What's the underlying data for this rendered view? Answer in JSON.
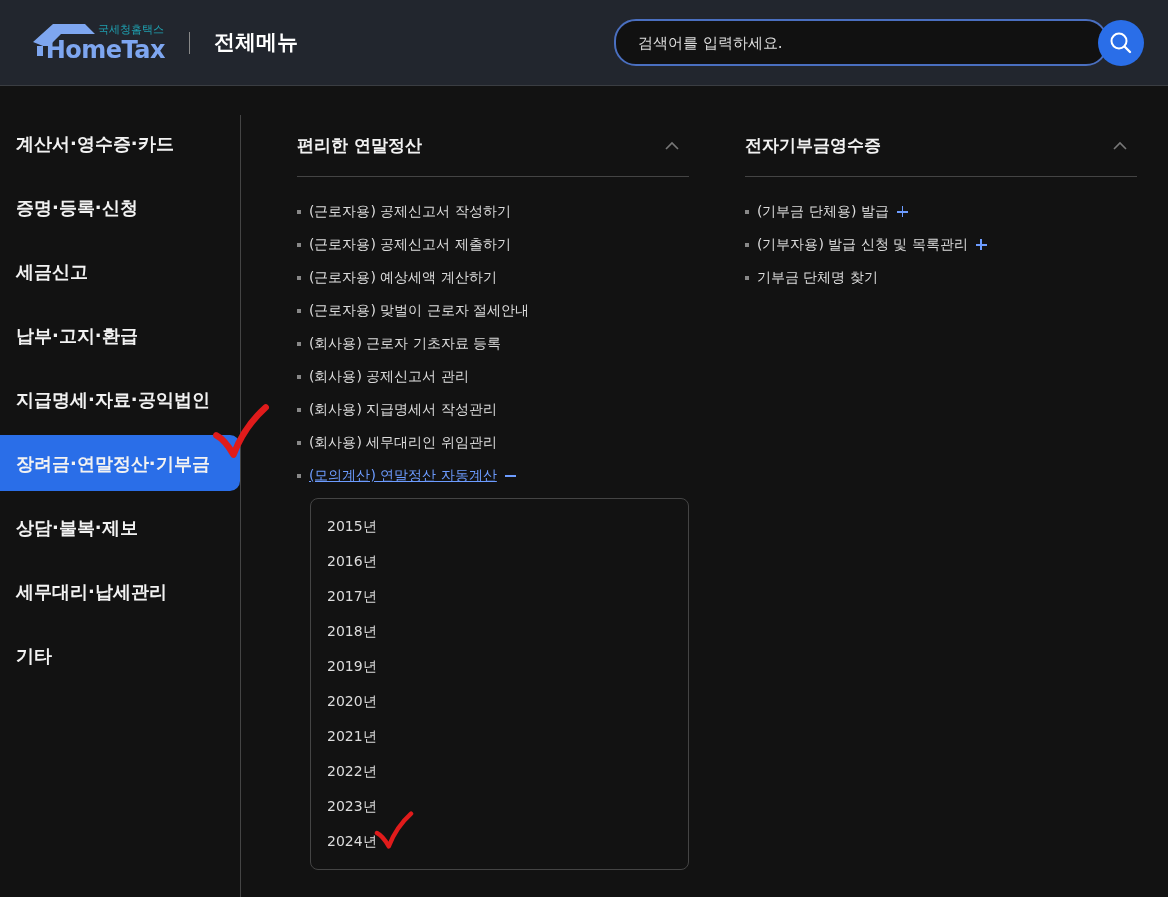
{
  "header": {
    "logo": {
      "subtitle": "국세청홈택스",
      "name": "HomeTax"
    },
    "title": "전체메뉴",
    "search": {
      "placeholder": "검색어를 입력하세요."
    }
  },
  "sidebar": {
    "items": [
      {
        "label": "계산서·영수증·카드",
        "selected": false,
        "marked": false
      },
      {
        "label": "증명·등록·신청",
        "selected": false,
        "marked": false
      },
      {
        "label": "세금신고",
        "selected": false,
        "marked": false
      },
      {
        "label": "납부·고지·환급",
        "selected": false,
        "marked": false
      },
      {
        "label": "지급명세·자료·공익법인",
        "selected": false,
        "marked": false
      },
      {
        "label": "장려금·연말정산·기부금",
        "selected": true,
        "marked": true
      },
      {
        "label": "상담·불복·제보",
        "selected": false,
        "marked": false
      },
      {
        "label": "세무대리·납세관리",
        "selected": false,
        "marked": false
      },
      {
        "label": "기타",
        "selected": false,
        "marked": false
      }
    ]
  },
  "sections": [
    {
      "title": "편리한 연말정산",
      "expanded": true,
      "items": [
        {
          "label": "(근로자용) 공제신고서 작성하기",
          "kind": "plain"
        },
        {
          "label": "(근로자용) 공제신고서 제출하기",
          "kind": "plain"
        },
        {
          "label": "(근로자용) 예상세액 계산하기",
          "kind": "plain"
        },
        {
          "label": "(근로자용) 맞벌이 근로자 절세안내",
          "kind": "plain"
        },
        {
          "label": "(회사용) 근로자 기초자료 등록",
          "kind": "plain"
        },
        {
          "label": "(회사용) 공제신고서 관리",
          "kind": "plain"
        },
        {
          "label": "(회사용) 지급명세서 작성관리",
          "kind": "plain"
        },
        {
          "label": "(회사용) 세무대리인 위임관리",
          "kind": "plain"
        },
        {
          "label": "(모의계산) 연말정산 자동계산",
          "kind": "toggle",
          "expanded": true,
          "children": [
            {
              "label": "2015년",
              "marked": false
            },
            {
              "label": "2016년",
              "marked": false
            },
            {
              "label": "2017년",
              "marked": false
            },
            {
              "label": "2018년",
              "marked": false
            },
            {
              "label": "2019년",
              "marked": false
            },
            {
              "label": "2020년",
              "marked": false
            },
            {
              "label": "2021년",
              "marked": false
            },
            {
              "label": "2022년",
              "marked": false
            },
            {
              "label": "2023년",
              "marked": false
            },
            {
              "label": "2024년",
              "marked": true
            }
          ]
        }
      ]
    },
    {
      "title": "전자기부금영수증",
      "expanded": true,
      "items": [
        {
          "label": "(기부금 단체용) 발급",
          "kind": "toggle",
          "expanded": false
        },
        {
          "label": "(기부자용) 발급 신청 및 목록관리",
          "kind": "toggle",
          "expanded": false
        },
        {
          "label": "기부금 단체명 찾기",
          "kind": "plain"
        }
      ]
    }
  ]
}
